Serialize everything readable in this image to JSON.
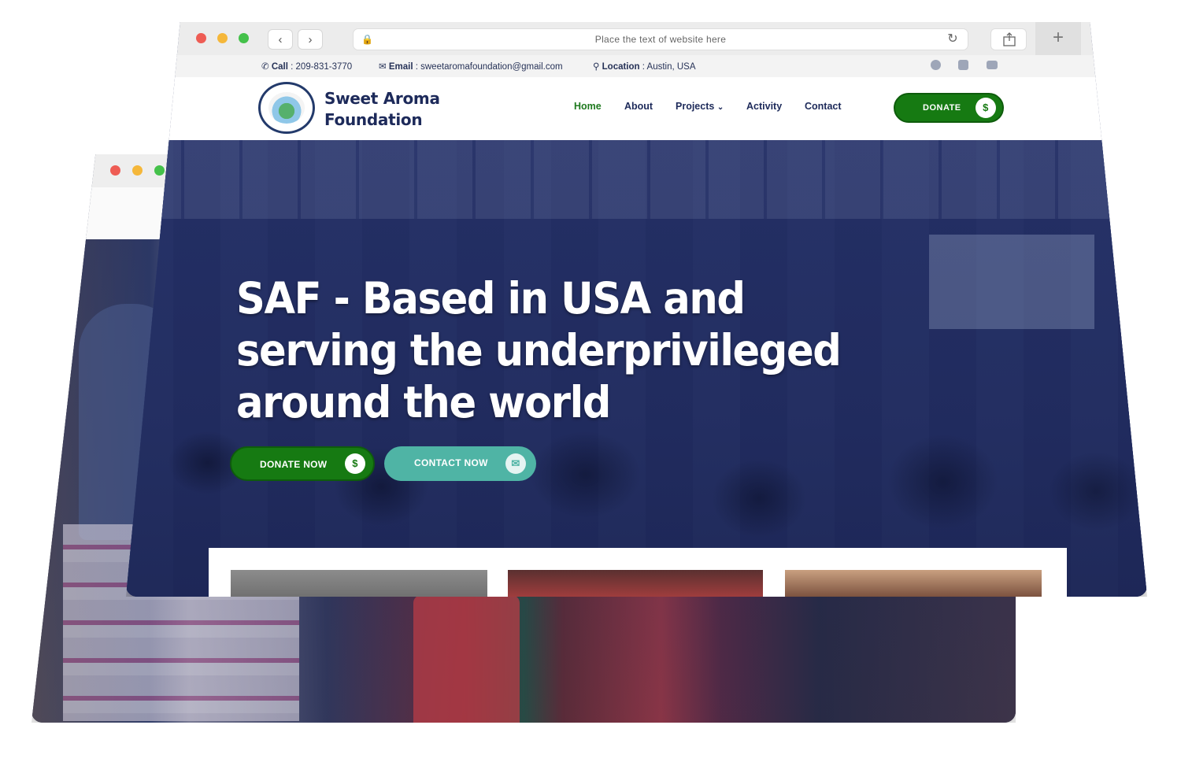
{
  "browser": {
    "address_placeholder": "Place the text of website here",
    "back_icon": "chevron-left-icon",
    "forward_icon": "chevron-right-icon",
    "reload_icon": "reload-icon",
    "share_icon": "share-icon",
    "new_tab_icon": "plus-icon"
  },
  "topbar": {
    "call_label": "Call",
    "call_value": ": 209-831-3770",
    "email_label": "Email",
    "email_value": ": sweetaromafoundation@gmail.com",
    "location_label": "Location",
    "location_value": ": Austin, USA",
    "social": [
      "facebook-icon",
      "twitter-icon",
      "youtube-icon"
    ]
  },
  "header": {
    "logo_line1": "Sweet Aroma",
    "logo_line2": "Foundation",
    "menu": [
      {
        "label": "Home",
        "active": true
      },
      {
        "label": "About"
      },
      {
        "label": "Projects"
      },
      {
        "label": "Activity"
      },
      {
        "label": "Contact"
      }
    ],
    "donate_label": "DONATE"
  },
  "hero": {
    "title": "SAF - Based in USA and serving the underprivileged around the world",
    "donate_now_label": "DONATE NOW",
    "contact_now_label": "CONTACT NOW"
  },
  "colors": {
    "brand_green": "#167a12",
    "brand_navy": "#1d2a5a",
    "contact_teal": "#4fb4a5",
    "hero_overlay": "#222d5e"
  }
}
